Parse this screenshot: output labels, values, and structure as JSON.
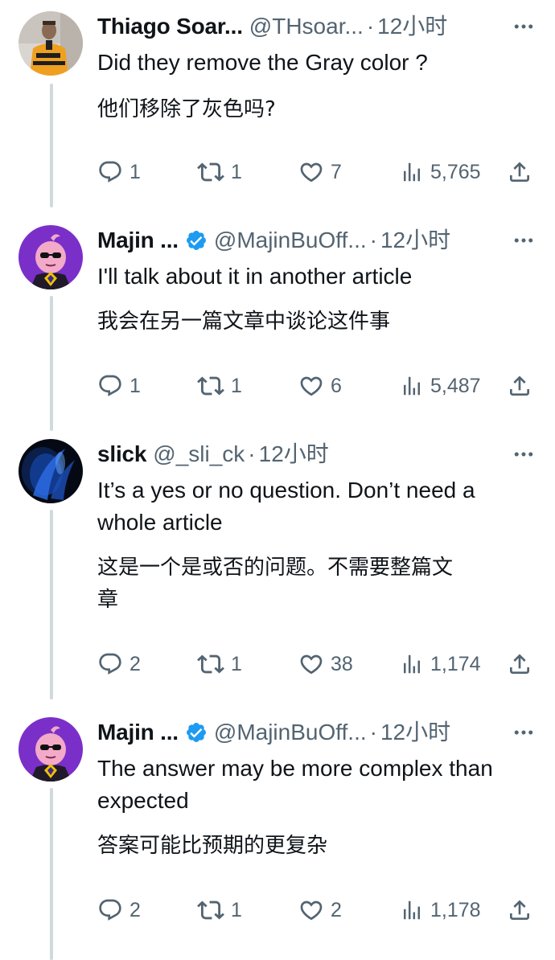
{
  "tweets": [
    {
      "name": "Thiago Soar...",
      "handle": "@THsoar...",
      "dot": "·",
      "time": "12小时",
      "verified": false,
      "text_en": "Did they remove the Gray color ?",
      "text_zh": "他们移除了灰色吗?",
      "replies": "1",
      "retweets": "1",
      "likes": "7",
      "views": "5,765"
    },
    {
      "name": "Majin ...",
      "handle": "@MajinBuOff...",
      "dot": "·",
      "time": "12小时",
      "verified": true,
      "text_en": "I'll talk about it in another article",
      "text_zh": "我会在另一篇文章中谈论这件事",
      "replies": "1",
      "retweets": "1",
      "likes": "6",
      "views": "5,487"
    },
    {
      "name": "slick",
      "handle": "@_sli_ck",
      "dot": "·",
      "time": "12小时",
      "verified": false,
      "text_en_1": "It’s a yes or no question. Don’t need a",
      "text_en_2": "whole article",
      "text_zh_1": "这是一个是或否的问题。不需要整篇文",
      "text_zh_2": "章",
      "replies": "2",
      "retweets": "1",
      "likes": "38",
      "views": "1,174"
    },
    {
      "name": "Majin ...",
      "handle": "@MajinBuOff...",
      "dot": "·",
      "time": "12小时",
      "verified": true,
      "text_en_1": "The answer may be more complex than",
      "text_en_2": "expected",
      "text_zh": "答案可能比预期的更复杂",
      "replies": "2",
      "retweets": "1",
      "likes": "2",
      "views": "1,178"
    }
  ],
  "colors": {
    "text": "#0f1419",
    "muted": "#536471",
    "thread_line": "#cfd9de",
    "verified": "#1d9bf0"
  },
  "icons": [
    "reply-icon",
    "retweet-icon",
    "like-icon",
    "views-icon",
    "share-icon",
    "more-icon",
    "verified-badge-icon"
  ]
}
